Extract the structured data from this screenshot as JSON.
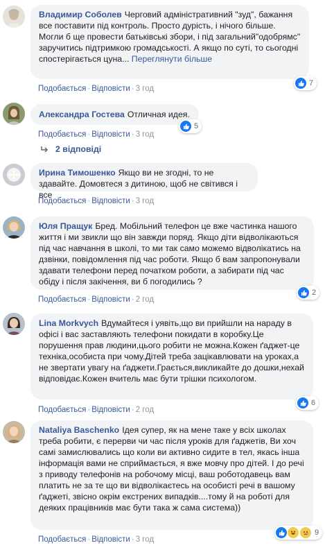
{
  "actions": {
    "like": "Подобається",
    "reply": "Відповісти",
    "see_more": "Переглянути більше"
  },
  "colors": {
    "link": "#385898",
    "bubble": "#f2f3f5",
    "like": "#1877f2"
  },
  "comments": [
    {
      "author": "Владимир Соболев",
      "text": "Черговий адміністративний \"зуд\", бажання все поставити під контроль. Просто дурість, і нічого більше. Могли б ще провести батьківські збори, і під загальний\"одобрямс\" заручитись підтримкою громадськості. А якщо по суті, то сьогодні спостерігається цуна...",
      "time": "3 год",
      "reactions": "7",
      "reaction_icons": [
        "like-icon"
      ]
    },
    {
      "author": "Александра Гостева",
      "text": "Отличная идея.",
      "time": "3 год",
      "reactions": "5",
      "reaction_icons": [
        "like-icon"
      ]
    },
    {
      "author": "Ирина Тимошенко",
      "text": "Якщо ви не згодні, то не здавайте. Домовтеся з дитиною, щоб не світився і все",
      "time": "3 год"
    },
    {
      "author": "Юля Пращук",
      "text": "Бред. Мобільний телефон це вже частинка нашого життя і ми звикли що він завжди поряд. Якщо діти відволікаються під час навчання в школі, то ми так само можемо відволікатись на дзвінки, повідомлення під час роботи. Якщо б вам запропонували здавати телефони перед початком роботи, а забирати під час обіду і після закічення, ви б погодились ?",
      "time": "2 год",
      "reactions": "2",
      "reaction_icons": [
        "like-icon"
      ]
    },
    {
      "author": "Lina Morkvych",
      "text": "Вдумайтеся і уявіть,що ви прийшли на нараду в офісі і вас заставляють телефони покидати в коробку.Це порушення прав людини,цього робити не можна.Кожен ґаджет-це техніка,особиста при чому.Дітей треба зацікавлювати на уроках,а не звертати увагу на ґаджети.Грається,викликайте до дошки,нехай відповідає.Кожен вчитель має бути трішки психологом.",
      "time": "2 год",
      "reactions": "6",
      "reaction_icons": [
        "like-icon"
      ]
    },
    {
      "author": "Nataliya Baschenko",
      "text": "Ідея супер, як на мене таке у всіх школах треба робити, є перерви чи час після уроків для ґаджетів, Ви хоч самі замислювались що коли ви активно сидите в тел, якась інша інформація вами не сприймається, я вже мовчу про дітей. І до речі з приводу телефонів на робочому місці, ваш роботодавець вам платить не за те що ви відволікаєтесь на особисті речі в вашому ґаджеті, звісно окрім екстрених випадків....тому й на роботі для деяких працівників має бути така ж сама система))",
      "time": "3 год",
      "reactions": "9",
      "reaction_icons": [
        "like-icon",
        "laugh-icon",
        "sad-icon"
      ]
    }
  ],
  "replies_link": "2 відповіді"
}
